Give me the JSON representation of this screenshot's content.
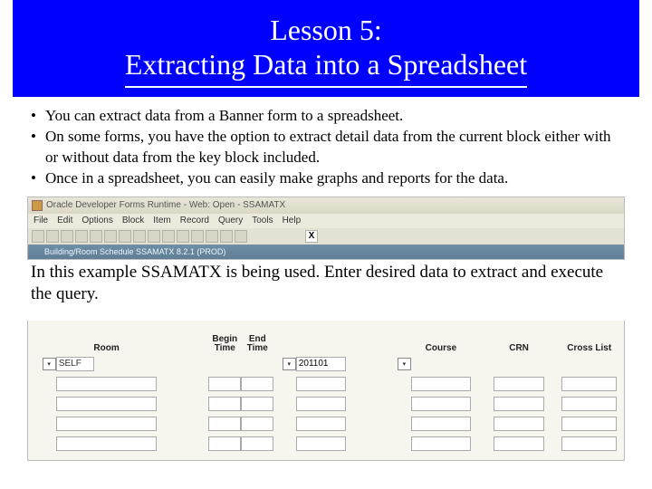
{
  "title": {
    "line1": "Lesson 5:",
    "line2": "Extracting Data into a Spreadsheet"
  },
  "bullets": [
    "You can extract data from a Banner form to a spreadsheet.",
    "On some forms, you have the option to extract detail data from the current block either with or without data from the key block included.",
    "Once in a spreadsheet, you can easily make graphs and reports for the data."
  ],
  "explain": "In this example SSAMATX is being used.  Enter desired data to extract and execute the query.",
  "shot": {
    "title": "Oracle Developer Forms Runtime - Web: Open - SSAMATX",
    "menu": [
      "File",
      "Edit",
      "Options",
      "Block",
      "Item",
      "Record",
      "Query",
      "Tools",
      "Help"
    ],
    "subbar": "Building/Room Schedule  SSAMATX  8.2.1  (PROD)",
    "x": "X"
  },
  "form": {
    "headers": {
      "room": "Room",
      "begin": "Begin Time",
      "end": "End Time",
      "course": "Course",
      "crn": "CRN",
      "cross": "Cross List"
    },
    "datefield_value": "201101",
    "self_label": "SELF",
    "dropdown_glyph": "▾"
  }
}
